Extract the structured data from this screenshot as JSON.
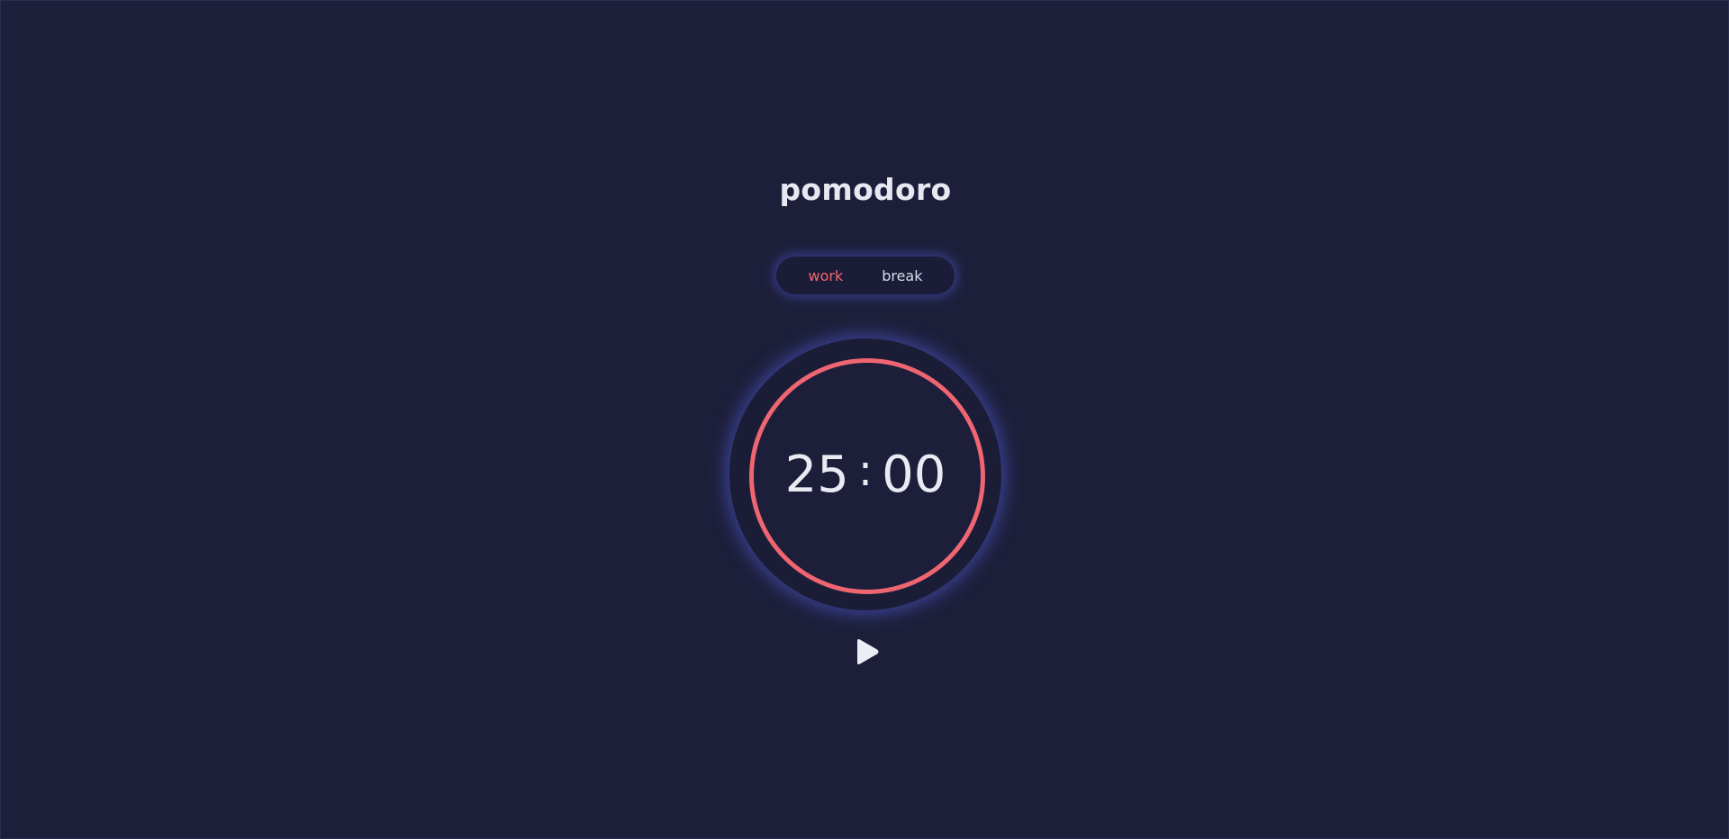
{
  "app": {
    "title": "pomodoro"
  },
  "modes": {
    "work_label": "work",
    "break_label": "break",
    "active": "work"
  },
  "timer": {
    "minutes": "25",
    "separator": ":",
    "seconds": "00",
    "progress": 1.0
  },
  "controls": {
    "play_icon": "play-icon"
  },
  "colors": {
    "background": "#1d1f3a",
    "accent": "#ef6572",
    "text": "#e9ebf3",
    "glow": "#525cdc"
  }
}
